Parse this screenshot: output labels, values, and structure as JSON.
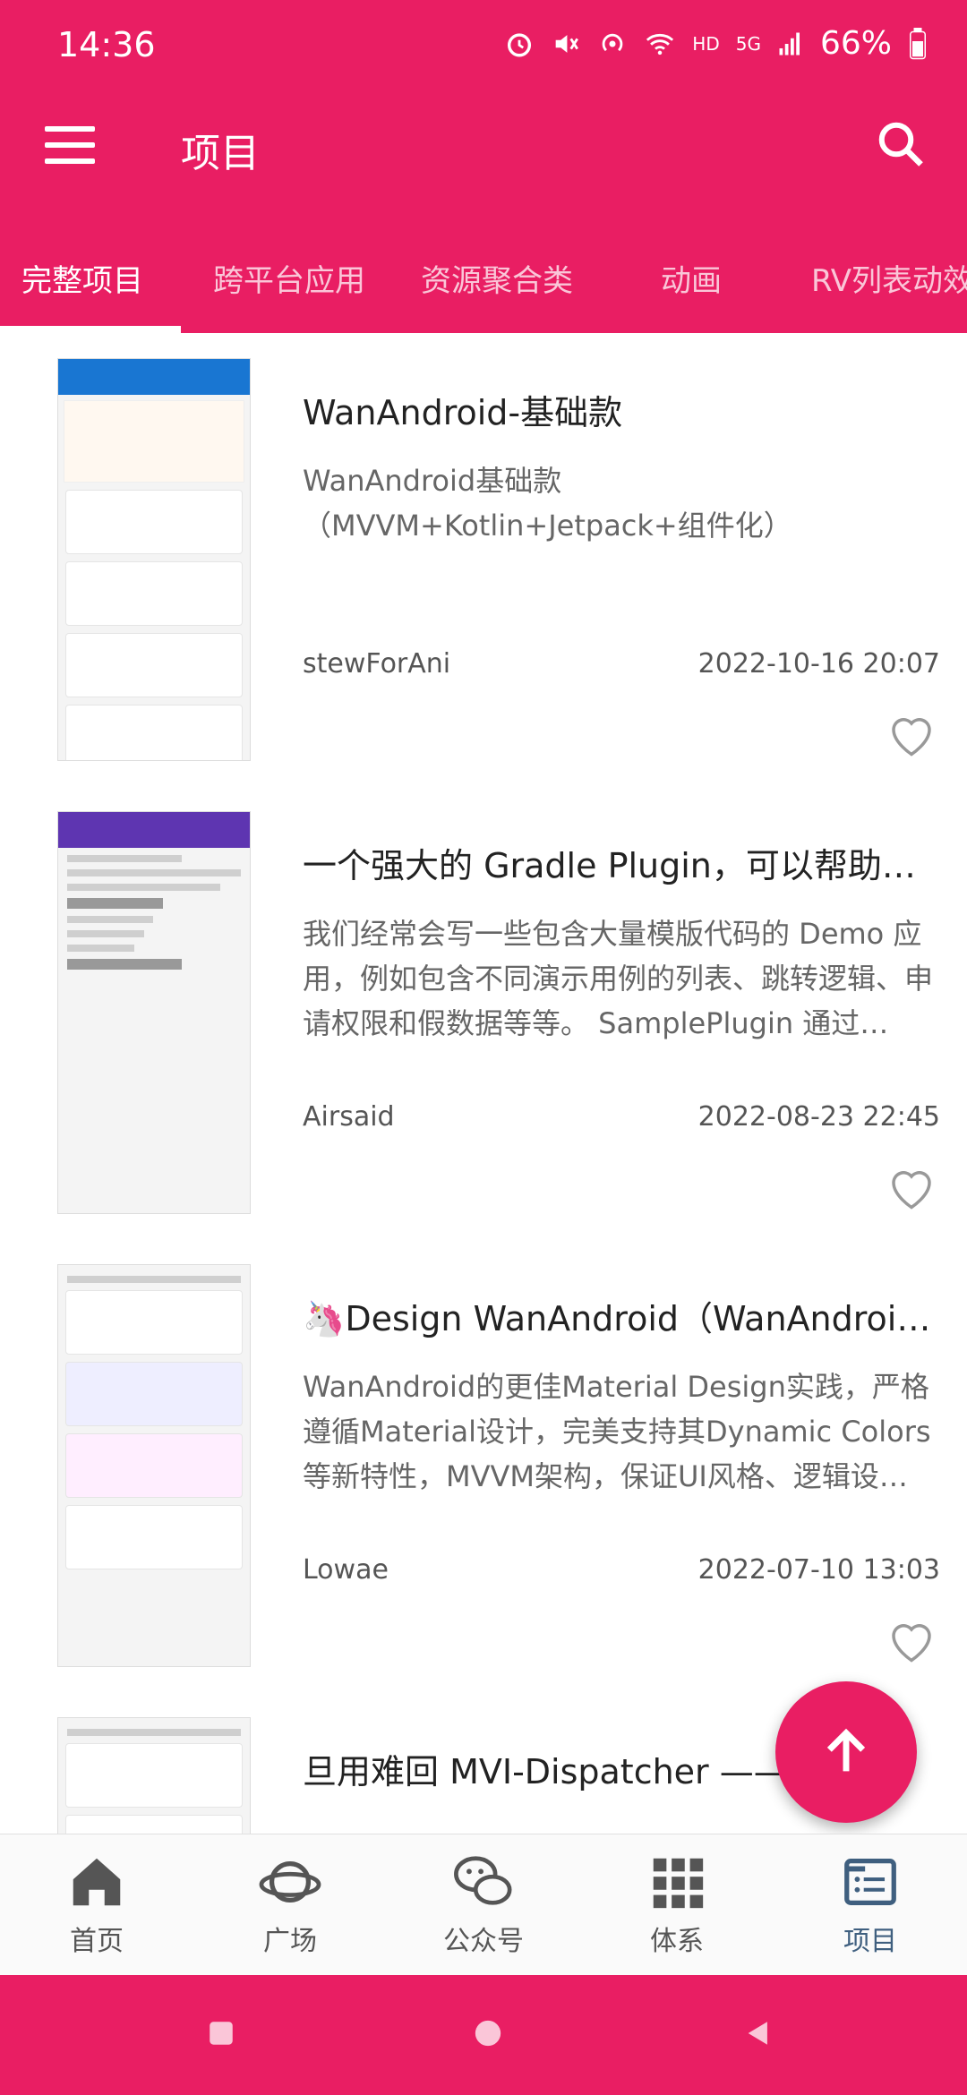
{
  "status_bar": {
    "time": "14:36",
    "network": "HD",
    "signal": "5G",
    "battery": "66%",
    "icons": [
      "alarm-icon",
      "mute-icon",
      "hotspot-icon",
      "wifi-icon",
      "signal-icon",
      "battery-icon"
    ]
  },
  "app_bar": {
    "title": "项目"
  },
  "tabs": [
    {
      "label": "完整项目"
    },
    {
      "label": "跨平台应用"
    },
    {
      "label": "资源聚合类"
    },
    {
      "label": "动画"
    },
    {
      "label": "RV列表动效"
    }
  ],
  "projects": [
    {
      "title": "WanAndroid-基础款",
      "desc": "WanAndroid基础款（MVVM+Kotlin+Jetpack+组件化）",
      "author": "stewForAni",
      "date": "2022-10-16 20:07"
    },
    {
      "title": "一个强大的 Gradle Plugin，可以帮助你…",
      "desc": "我们经常会写一些包含大量模版代码的 Demo 应用，例如包含不同演示用例的列表、跳转逻辑、申请权限和假数据等等。 SamplePlugin 通过…",
      "author": "Airsaid",
      "date": "2022-08-23 22:45"
    },
    {
      "title": "🦄Design WanAndroid（WanAndroid…",
      "desc": "WanAndroid的更佳Material Design实践，严格遵循Material设计，完美支持其Dynamic Colors等新特性，MVVM架构，保证UI风格、逻辑设…",
      "author": "Lowae",
      "date": "2022-07-10 13:03"
    },
    {
      "title": "旦用难回 MVI-Dispatcher —— …",
      "desc": "",
      "author": "",
      "date": ""
    }
  ],
  "bottom_nav": [
    {
      "label": "首页",
      "icon": "home-icon"
    },
    {
      "label": "广场",
      "icon": "planet-icon"
    },
    {
      "label": "公众号",
      "icon": "wechat-icon"
    },
    {
      "label": "体系",
      "icon": "grid-icon"
    },
    {
      "label": "项目",
      "icon": "list-icon",
      "active": true
    }
  ],
  "colors": {
    "primary": "#E91E63",
    "nav_active": "#3F5F7F"
  }
}
